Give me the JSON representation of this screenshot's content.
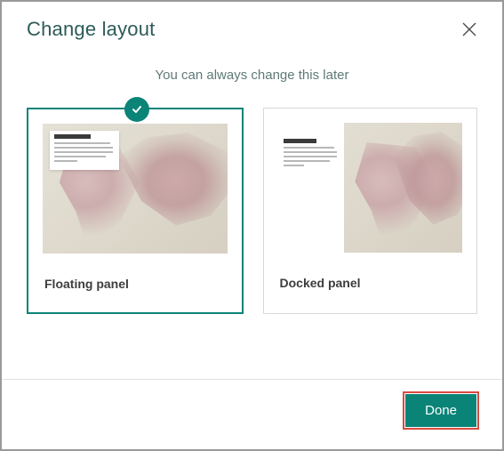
{
  "dialog": {
    "title": "Change layout",
    "subtitle": "You can always change this later"
  },
  "options": [
    {
      "label": "Floating panel",
      "selected": true
    },
    {
      "label": "Docked panel",
      "selected": false
    }
  ],
  "actions": {
    "done": "Done"
  },
  "colors": {
    "accent": "#0b8478",
    "highlight_border": "#d84b3f"
  }
}
